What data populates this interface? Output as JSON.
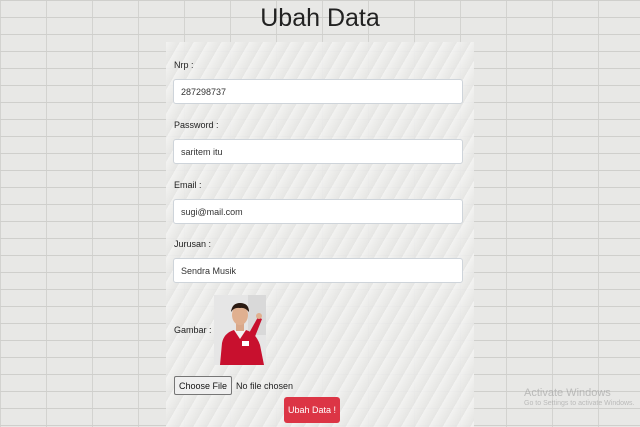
{
  "page": {
    "title": "Ubah Data"
  },
  "form": {
    "nrp": {
      "label": "Nrp :",
      "value": "287298737"
    },
    "password": {
      "label": "Password :",
      "value": "saritem itu"
    },
    "email": {
      "label": "Email :",
      "value": "sugi@mail.com"
    },
    "jurusan": {
      "label": "Jurusan :",
      "value": "Sendra Musik"
    },
    "gambar": {
      "label": "Gambar :"
    },
    "file_input": {
      "button_label": "Choose File",
      "status": "No file chosen"
    },
    "submit_label": "Ubah Data !"
  },
  "watermark": {
    "title": "Activate Windows",
    "subtitle": "Go to Settings to activate Windows."
  },
  "colors": {
    "submit": "#dc3545",
    "background": "#e8e8e6"
  }
}
